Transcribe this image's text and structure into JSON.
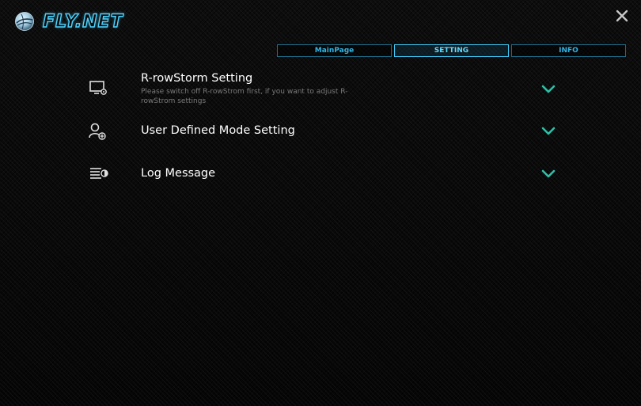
{
  "app": {
    "name": "FLY.NET",
    "accent_color": "#4fd3ff"
  },
  "tabs": [
    {
      "label": "MainPage",
      "active": false
    },
    {
      "label": "SETTING",
      "active": true
    },
    {
      "label": "INFO",
      "active": false
    }
  ],
  "settings": [
    {
      "title": "R-rowStorm Setting",
      "description": "Please switch off R-rowStrom first, if you want to adjust R-rowStrom settings",
      "icon": "monitor-settings-icon",
      "expand_icon": "chevron-down-icon"
    },
    {
      "title": "User Defined Mode Setting",
      "icon": "user-add-icon",
      "expand_icon": "chevron-down-icon"
    },
    {
      "title": "Log Message",
      "icon": "log-list-icon",
      "expand_icon": "chevron-down-icon"
    }
  ],
  "colors": {
    "chevron": "#2fc0a8",
    "tab_border": "#1f6d8a",
    "tab_active": "#3ec8f5"
  }
}
